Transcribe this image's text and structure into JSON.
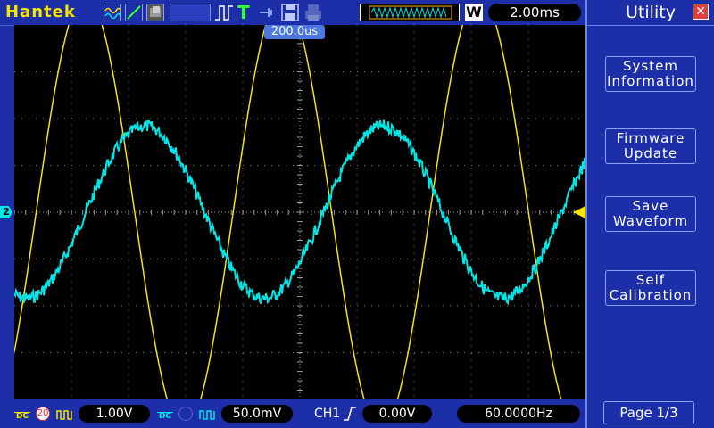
{
  "brand": "Hantek",
  "toolbar": {
    "icons": [
      "waveform-display-icon",
      "vectors-icon",
      "persistence-icon",
      "trigger-pulse-icon",
      "trigger-T-icon",
      "connection-icon",
      "save-icon",
      "print-icon"
    ],
    "run_status": "W",
    "timebase": "2.00ms"
  },
  "display": {
    "horizontal_position": "200.0us",
    "ch2_marker": "2",
    "colors": {
      "ch1": "#f5e600",
      "ch2": "#00e6e6",
      "grid": "#7a7a7a"
    },
    "ch1_wave": {
      "cycles": 2.9,
      "phase_deg": -40,
      "amplitude_fraction": 0.58
    },
    "ch2_wave": {
      "cycles": 2.4,
      "phase_deg": -108,
      "amplitude_fraction": 0.23
    }
  },
  "sidebar": {
    "title": "Utility",
    "buttons": [
      {
        "line1": "System",
        "line2": "Information"
      },
      {
        "line1": "Firmware",
        "line2": "Update"
      },
      {
        "line1": "Save",
        "line2": "Waveform"
      },
      {
        "line1": "Self",
        "line2": "Calibration"
      }
    ],
    "page": "Page 1/3"
  },
  "bottom": {
    "ch1": {
      "coupling": "DC",
      "bw_limit": "20",
      "scale": "1.00V"
    },
    "ch2": {
      "coupling": "DC",
      "scale": "50.0mV"
    },
    "trigger": {
      "source": "CH1",
      "level": "0.00V"
    },
    "frequency": "60.0000Hz"
  }
}
